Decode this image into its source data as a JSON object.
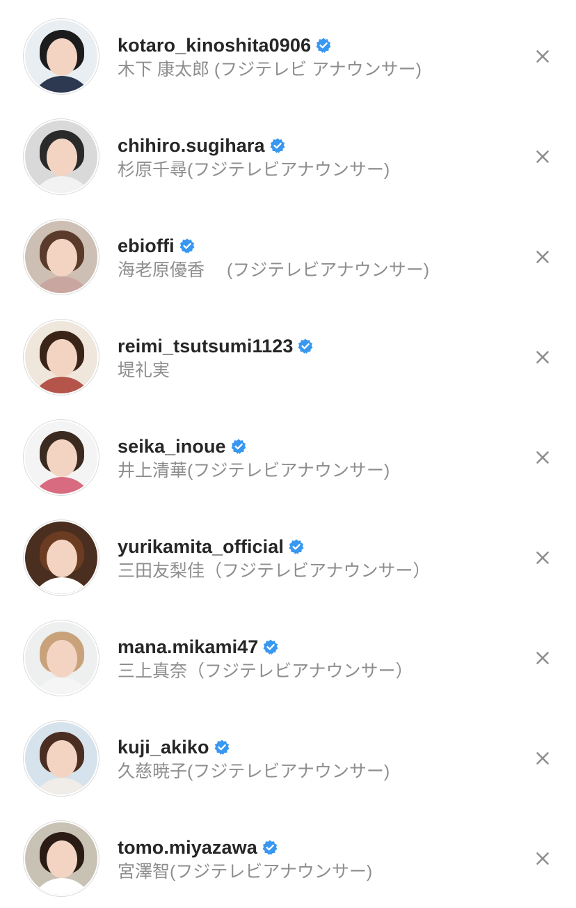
{
  "accounts": [
    {
      "username": "kotaro_kinoshita0906",
      "fullname": "木下 康太郎 (フジテレビ アナウンサー)",
      "bg": "#e9eef2",
      "hair": "#1c1c1c",
      "body": "#2d3950"
    },
    {
      "username": "chihiro.sugihara",
      "fullname": "杉原千尋(フジテレビアナウンサー)",
      "bg": "#d9d9d9",
      "hair": "#2a2a2a",
      "body": "#f2f2f2"
    },
    {
      "username": "ebioffi",
      "fullname": "海老原優香　 (フジテレビアナウンサー)",
      "bg": "#cdbfb3",
      "hair": "#5a3a2a",
      "body": "#c9a7a0"
    },
    {
      "username": "reimi_tsutsumi1123",
      "fullname": "堤礼実",
      "bg": "#efe6dc",
      "hair": "#3a2418",
      "body": "#b5544a"
    },
    {
      "username": "seika_inoue",
      "fullname": "井上清華(フジテレビアナウンサー)",
      "bg": "#f4f4f4",
      "hair": "#3b2a20",
      "body": "#d86b7f"
    },
    {
      "username": "yurikamita_official",
      "fullname": "三田友梨佳（フジテレビアナウンサー）",
      "bg": "#4a2e1f",
      "hair": "#6b3c22",
      "body": "#ffffff"
    },
    {
      "username": "mana.mikami47",
      "fullname": "三上真奈（フジテレビアナウンサー）",
      "bg": "#eef0f0",
      "hair": "#c9a27c",
      "body": "#f5f5f5"
    },
    {
      "username": "kuji_akiko",
      "fullname": "久慈暁子(フジテレビアナウンサー)",
      "bg": "#d6e2ec",
      "hair": "#4a2e22",
      "body": "#f0ece8"
    },
    {
      "username": "tomo.miyazawa",
      "fullname": "宮澤智(フジテレビアナウンサー)",
      "bg": "#c8c2b4",
      "hair": "#2a1c14",
      "body": "#ffffff"
    }
  ],
  "colors": {
    "verified": "#3897f0",
    "secondary_text": "#8e8e8e",
    "dismiss": "#8e8e8e"
  },
  "icons": {
    "verified": "verified-badge-icon",
    "dismiss": "close-icon"
  }
}
